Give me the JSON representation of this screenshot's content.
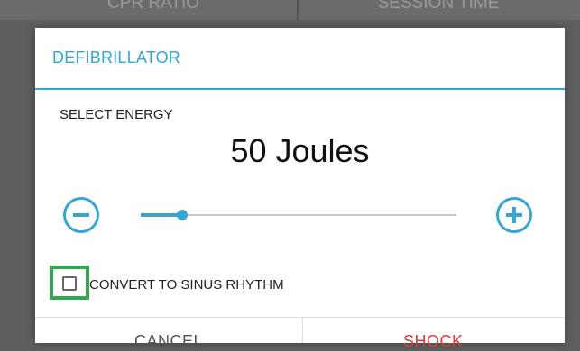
{
  "background": {
    "tab_left_label": "CPR RATIO",
    "tab_right_label": "SESSION TIME"
  },
  "dialog": {
    "title": "DEFIBRILLATOR",
    "select_label": "SELECT ENERGY",
    "energy_value": "50 Joules",
    "energy_fraction": 0.13,
    "decrease_icon": "minus-circle-icon",
    "increase_icon": "plus-circle-icon",
    "checkbox": {
      "label": "CONVERT TO SINUS RHYTHM",
      "checked": false
    },
    "buttons": {
      "cancel": "CANCEL",
      "shock": "SHOCK"
    }
  },
  "colors": {
    "accent": "#33a6d6",
    "highlight": "#2fa84f",
    "shock": "#e53935",
    "cancel": "#555555"
  }
}
